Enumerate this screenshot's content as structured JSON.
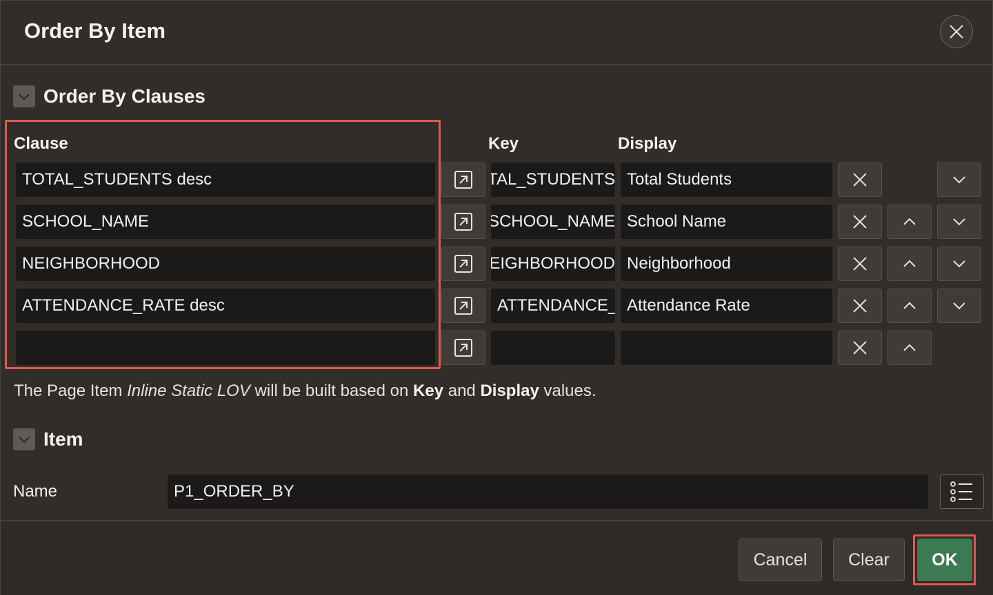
{
  "dialog": {
    "title": "Order By Item"
  },
  "order_by_section": {
    "title": "Order By Clauses",
    "headers": {
      "clause": "Clause",
      "key": "Key",
      "display": "Display"
    },
    "rows": [
      {
        "clause": "TOTAL_STUDENTS desc",
        "key": "TOTAL_STUDENTS",
        "display": "Total Students"
      },
      {
        "clause": "SCHOOL_NAME",
        "key": "SCHOOL_NAME",
        "display": "School Name"
      },
      {
        "clause": "NEIGHBORHOOD",
        "key": "NEIGHBORHOOD",
        "display": "Neighborhood"
      },
      {
        "clause": "ATTENDANCE_RATE desc",
        "key": "ATTENDANCE_RATE",
        "display": "Attendance Rate"
      },
      {
        "clause": "",
        "key": "",
        "display": ""
      }
    ],
    "help": {
      "prefix": "The Page Item ",
      "item_type": "Inline Static LOV",
      "middle": " will be built based on ",
      "key_word": "Key",
      "and_word": " and ",
      "display_word": "Display",
      "suffix": " values."
    }
  },
  "item_section": {
    "title": "Item",
    "name_label": "Name",
    "name_value": "P1_ORDER_BY"
  },
  "footer": {
    "cancel_label": "Cancel",
    "clear_label": "Clear",
    "ok_label": "OK"
  },
  "colors": {
    "background": "#312d2a",
    "field": "#1c1a19",
    "highlight": "#e05a4a",
    "primary": "#3c7a54"
  },
  "icons": {
    "close": "close-icon",
    "collapse": "chevron-down-icon",
    "open_clause": "open-in-dialog-icon",
    "remove": "x-icon",
    "move_up": "chevron-up-icon",
    "move_down": "chevron-down-icon",
    "list": "list-icon"
  }
}
